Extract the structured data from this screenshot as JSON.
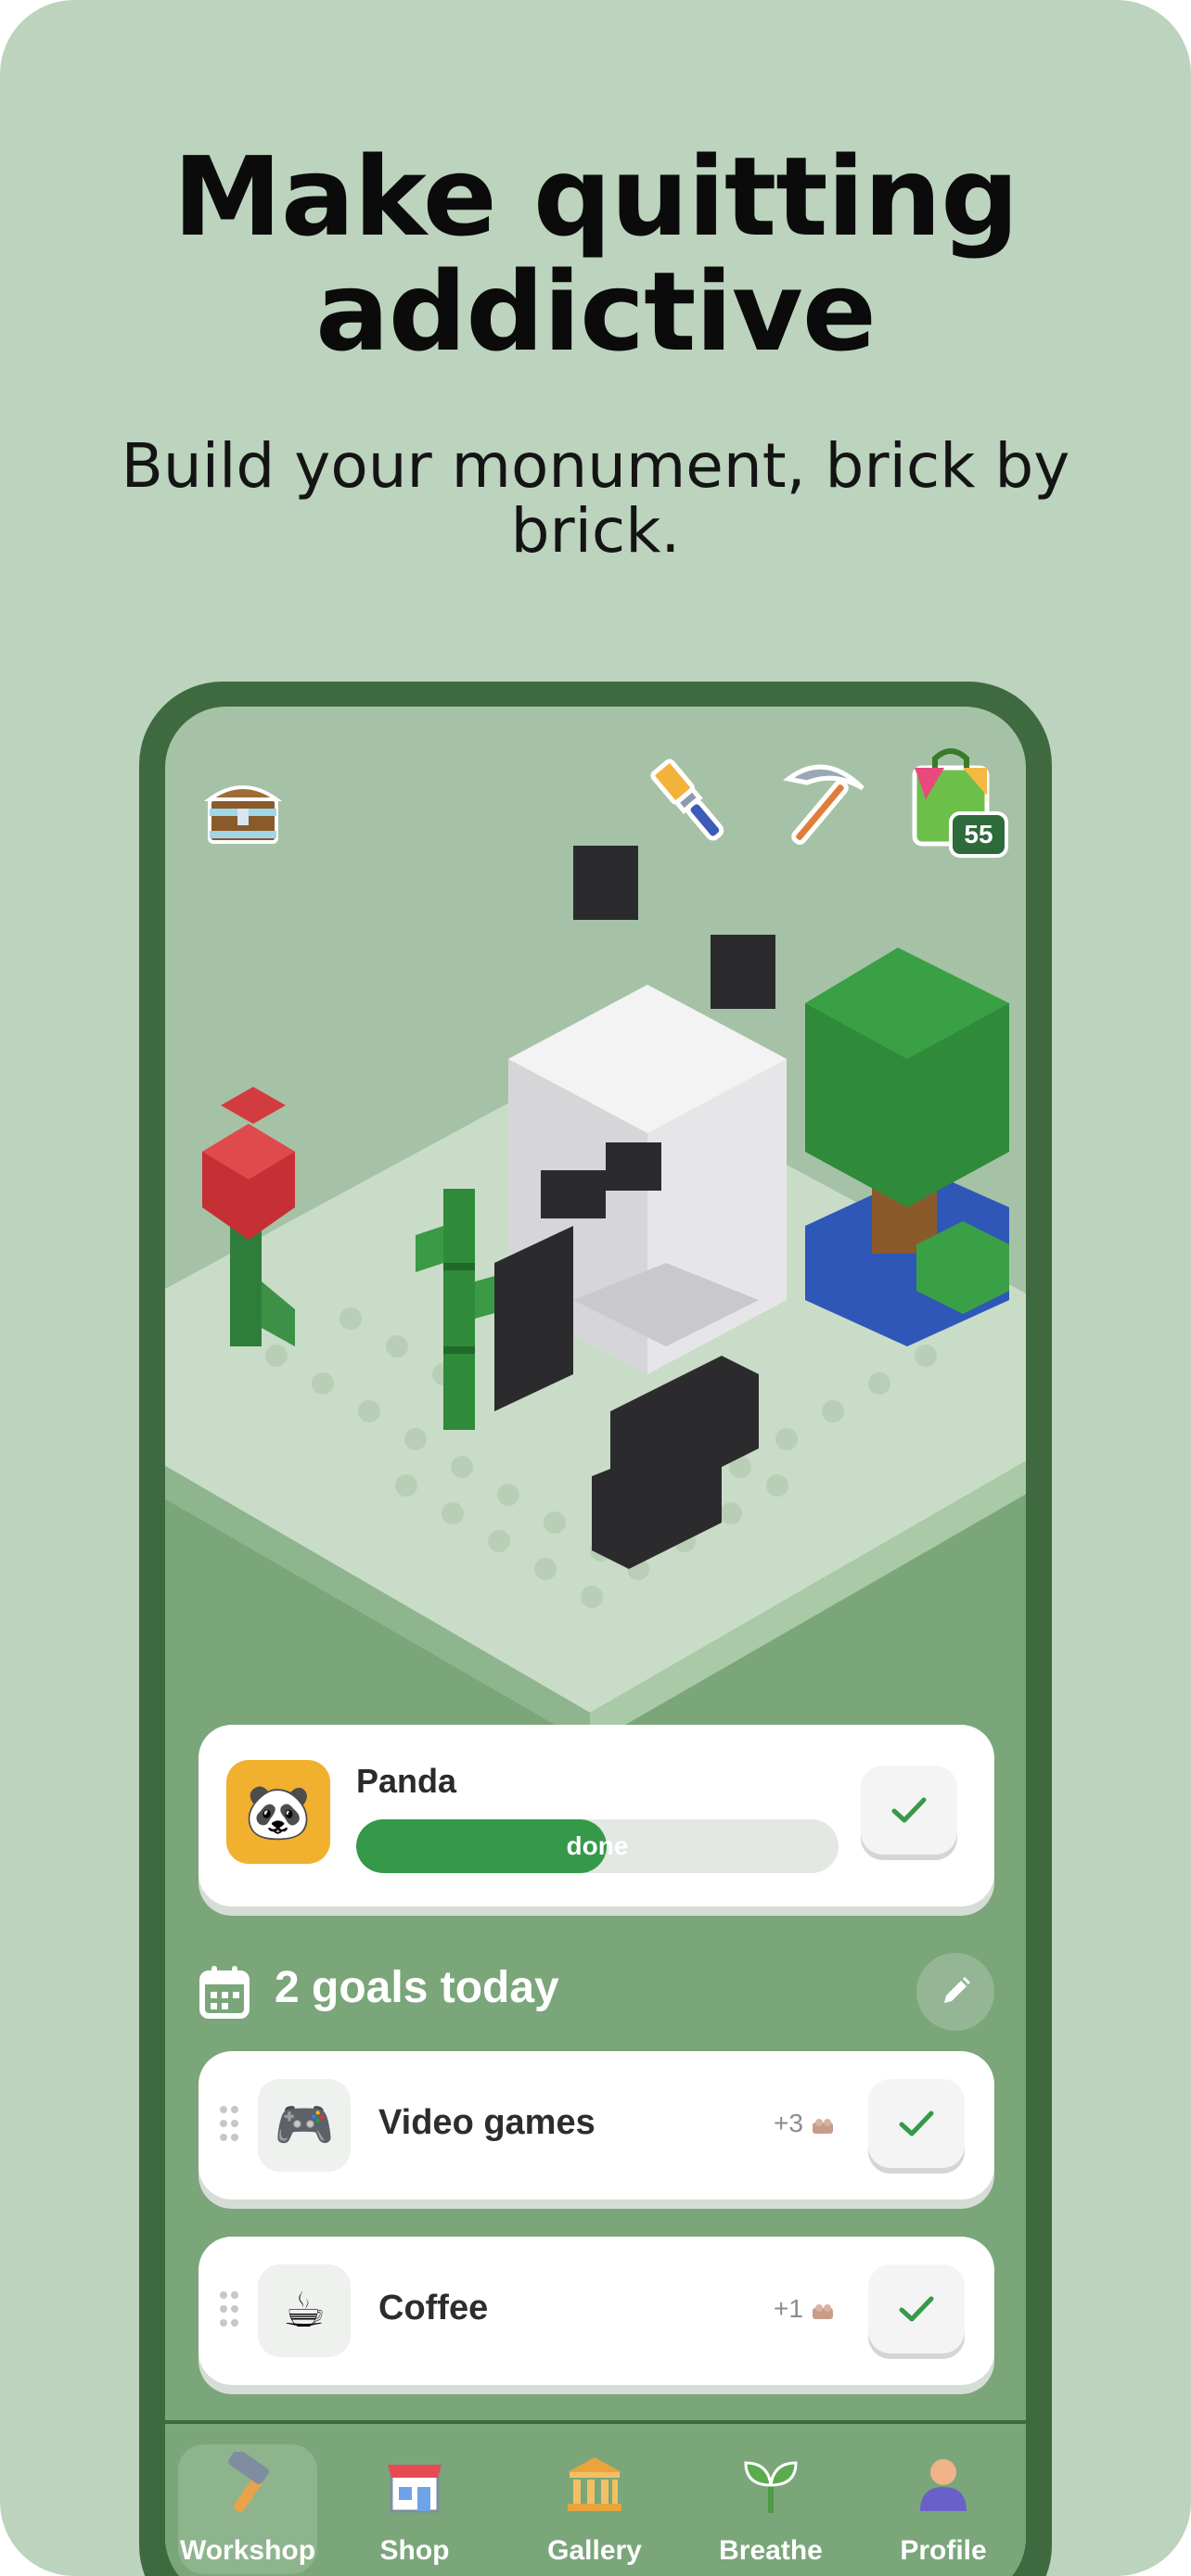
{
  "hero": {
    "title_line1": "Make quitting",
    "title_line2": "addictive",
    "subtitle": "Build your monument, brick by brick."
  },
  "top_bar": {
    "icons": [
      "treasure-chest-icon",
      "paint-brush-icon",
      "pickaxe-icon",
      "shopping-bag-icon"
    ],
    "bag_badge": "55"
  },
  "build": {
    "name": "Panda",
    "emoji": "🐼",
    "progress_label": "done",
    "progress": 0.52
  },
  "goals": {
    "title": "2 goals today",
    "items": [
      {
        "name": "Video games",
        "emoji": "🎮",
        "points": "+3"
      },
      {
        "name": "Coffee",
        "emoji": "☕",
        "points": "+1"
      }
    ]
  },
  "tabs": [
    {
      "label": "Workshop",
      "icon": "hammer-icon",
      "active": true
    },
    {
      "label": "Shop",
      "icon": "store-icon",
      "active": false
    },
    {
      "label": "Gallery",
      "icon": "museum-icon",
      "active": false
    },
    {
      "label": "Breathe",
      "icon": "sprout-icon",
      "active": false
    },
    {
      "label": "Profile",
      "icon": "person-icon",
      "active": false
    }
  ],
  "colors": {
    "background": "#bcd3bd",
    "frame": "#3f6a40",
    "screen": "#a6c2a6",
    "accent_green": "#36994a",
    "avatar_yellow": "#f1b12e"
  }
}
